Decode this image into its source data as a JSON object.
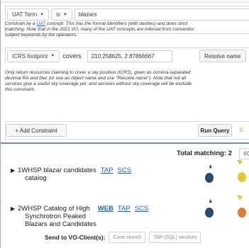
{
  "constraints": [
    {
      "field": "UAT Term",
      "operator": "is",
      "value": "blazars",
      "description_lines": [
        [
          "Constrain by a ",
          "UAT",
          " concept. This has the formal identifiers (with dashes) and does strict"
        ],
        [
          "matching. Note that in the 2021 VO, many of the UAT concepts are inferred from conventior"
        ],
        [
          "subject keywords by the operators."
        ]
      ]
    },
    {
      "field": "ICRS footprint",
      "operator": "covers",
      "value": "210.258625, 2.87866667",
      "button": "Resolve name",
      "description_lines": [
        "Only return resources claiming to cover a sky position (ICRS), given as comma-separated",
        "decimal RA and Dec (or use an object name and use \"Resolve name\"). Note that not all",
        "services give a useful sky coverage yet, and services without sky coverage will be exclude",
        "this constraint."
      ]
    }
  ],
  "toolbar": {
    "add_constraint": "+ Add Constraint",
    "run_query": "Run Query",
    "spinner_glyph": "⧖"
  },
  "results": {
    "total_label": "Total matching: 2",
    "total_tab": "SQ",
    "items": [
      {
        "title_lines": [
          "1WHSP blazar candidates",
          "catalog"
        ],
        "protocols": [
          "TAP",
          "SCS"
        ]
      },
      {
        "title_lines": [
          "2WHSP Catalog of High",
          "Synchrotron Peaked",
          "Blazars and Candidates"
        ],
        "protocols": [
          "WEB",
          "TAP",
          "SCS"
        ]
      }
    ],
    "send_label": "Send to VO-Client(s):",
    "clients": [
      "Cone search",
      "TAP (SQL) services"
    ]
  },
  "colors": {
    "link": "#2a5db0",
    "separator": "#6b8fc4",
    "footprint_dark": "#2b4a6b",
    "footprint_yellow": "#e5c637",
    "footprint_orange": "#e07b2f"
  },
  "icons": {
    "toggle": "triangle-right-icon",
    "sky_plot": "sky-coverage-icon"
  }
}
